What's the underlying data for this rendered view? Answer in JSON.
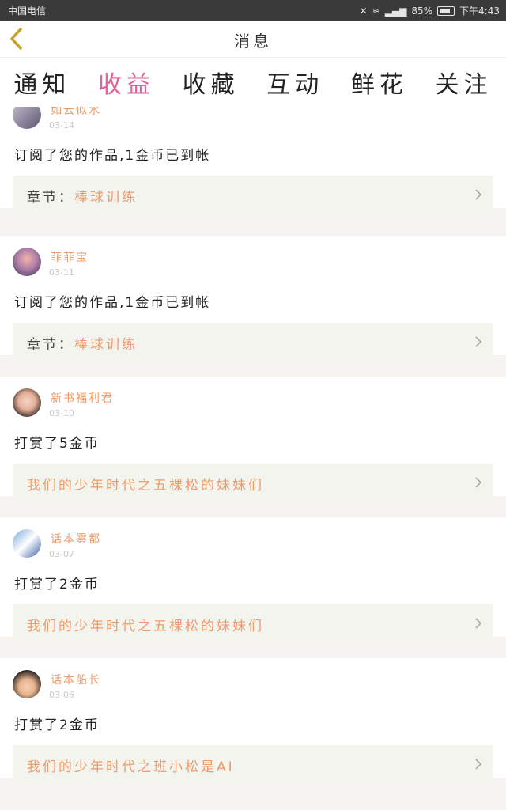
{
  "status": {
    "carrier": "中国电信",
    "battery": "85%",
    "time": "下午4:43"
  },
  "header": {
    "title": "消息"
  },
  "tabs": [
    {
      "label": "通知"
    },
    {
      "label": "收益"
    },
    {
      "label": "收藏"
    },
    {
      "label": "互动"
    },
    {
      "label": "鲜花"
    },
    {
      "label": "关注"
    }
  ],
  "active_tab": "收益",
  "items": [
    {
      "user": "如云似水",
      "date": "03-14",
      "message": "订阅了您的作品,1金币已到帐",
      "ref_prefix": "章节：",
      "ref": "棒球训练"
    },
    {
      "user": "菲菲宝",
      "date": "03-11",
      "message": "订阅了您的作品,1金币已到帐",
      "ref_prefix": "章节：",
      "ref": "棒球训练"
    },
    {
      "user": "新书福利君",
      "date": "03-10",
      "message": "打赏了5金币",
      "ref_prefix": "",
      "ref": "我们的少年时代之五棵松的妹妹们"
    },
    {
      "user": "话本雾都",
      "date": "03-07",
      "message": "打赏了2金币",
      "ref_prefix": "",
      "ref": "我们的少年时代之五棵松的妹妹们"
    },
    {
      "user": "话本船长",
      "date": "03-06",
      "message": "打赏了2金币",
      "ref_prefix": "",
      "ref": "我们的少年时代之班小松是AI"
    }
  ],
  "colors": {
    "accent": "#e0609a",
    "name": "#f09a66",
    "back": "#c9a027"
  }
}
